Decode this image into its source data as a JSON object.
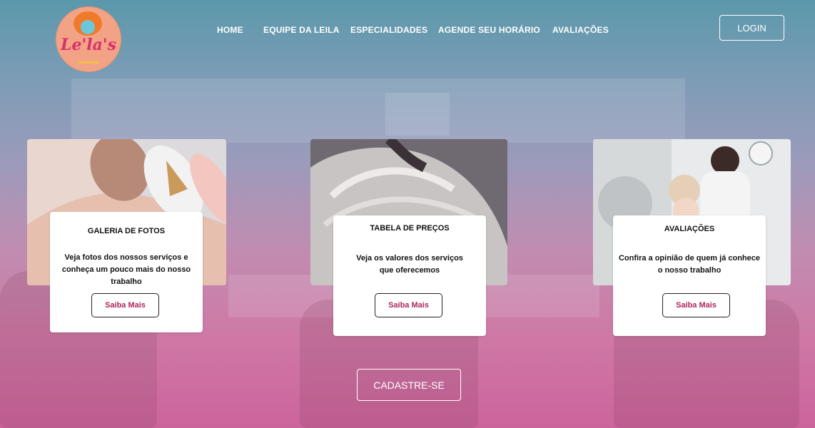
{
  "brand": {
    "logo_text": "Le'la's"
  },
  "nav": {
    "items": [
      {
        "label": "HOME"
      },
      {
        "label": "EQUIPE DA LEILA"
      },
      {
        "label": "ESPECIALIDADES"
      },
      {
        "label": "AGENDE SEU HORÁRIO"
      },
      {
        "label": "AVALIAÇÕES"
      }
    ],
    "login_label": "LOGIN"
  },
  "cards": [
    {
      "title": "GALERIA DE FOTOS",
      "description": "Veja fotos dos nossos serviços e conheça um pouco mais do nosso trabalho",
      "button_label": "Saiba Mais",
      "image": "nails-photo"
    },
    {
      "title": "TABELA DE PREÇOS",
      "description": "Veja os valores dos serviços que oferecemos",
      "button_label": "Saiba Mais",
      "image": "hair-photo"
    },
    {
      "title": "AVALIAÇÕES",
      "description": "Confira a opinião de quem já conhece o nosso trabalho",
      "button_label": "Saiba Mais",
      "image": "salon-photo"
    }
  ],
  "signup_label": "CADASTRE-SE",
  "colors": {
    "accent": "#b0245e",
    "bg_top": "#5b98ab",
    "bg_bottom": "#cc649c"
  }
}
